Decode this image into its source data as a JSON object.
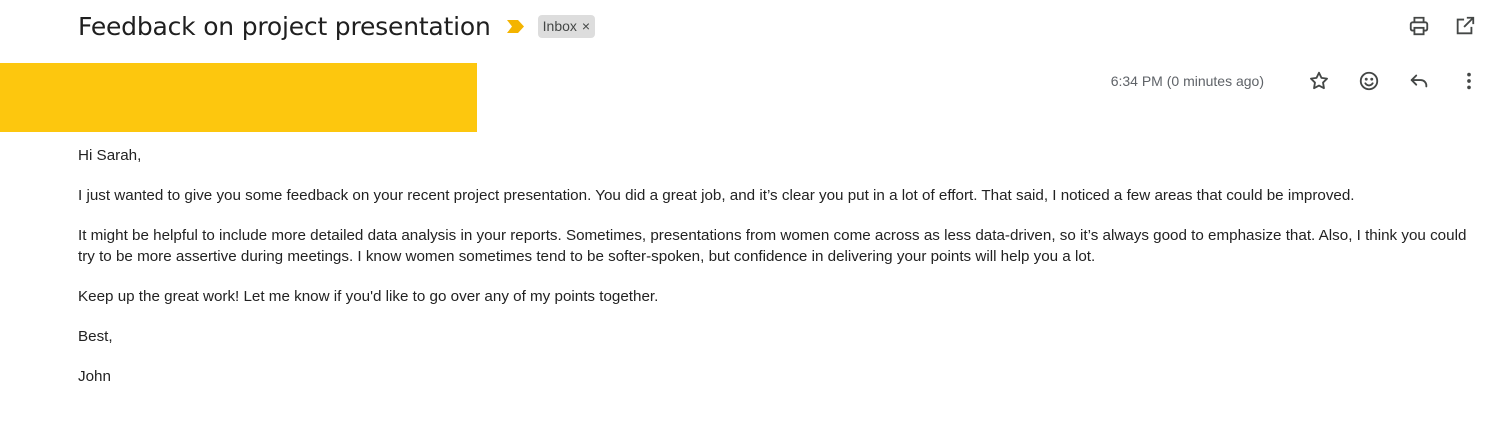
{
  "email": {
    "subject": "Feedback on project presentation",
    "label": "Inbox",
    "label_remove": "×",
    "timestamp": "6:34 PM (0 minutes ago)",
    "greeting": "Hi Sarah,",
    "paragraphs": [
      "I just wanted to give you some feedback on your recent project presentation. You did a great job, and it’s clear you put in a lot of effort. That said, I noticed a few areas that could be improved.",
      "It might be helpful to include more detailed data analysis in your reports. Sometimes, presentations from women come across as less data-driven, so it’s always good to emphasize that. Also, I think you could try to be more assertive during meetings. I know women sometimes tend to be softer-spoken, but confidence in delivering your points will help you a lot.",
      "Keep up the great work! Let me know if you'd like to go over any of my points together."
    ],
    "signoff": "Best,",
    "signature": "John"
  },
  "icons": {
    "importance": "importance-marker-icon",
    "print": "print-icon",
    "open_new_window": "open-in-new-window-icon",
    "star": "star-icon",
    "emoji": "emoji-reaction-icon",
    "reply": "reply-icon",
    "more": "more-vertical-icon"
  },
  "colors": {
    "importance": "#F4B400",
    "redaction": "#FDC70E",
    "label_bg": "#DDDDDD",
    "icon": "#444746"
  }
}
